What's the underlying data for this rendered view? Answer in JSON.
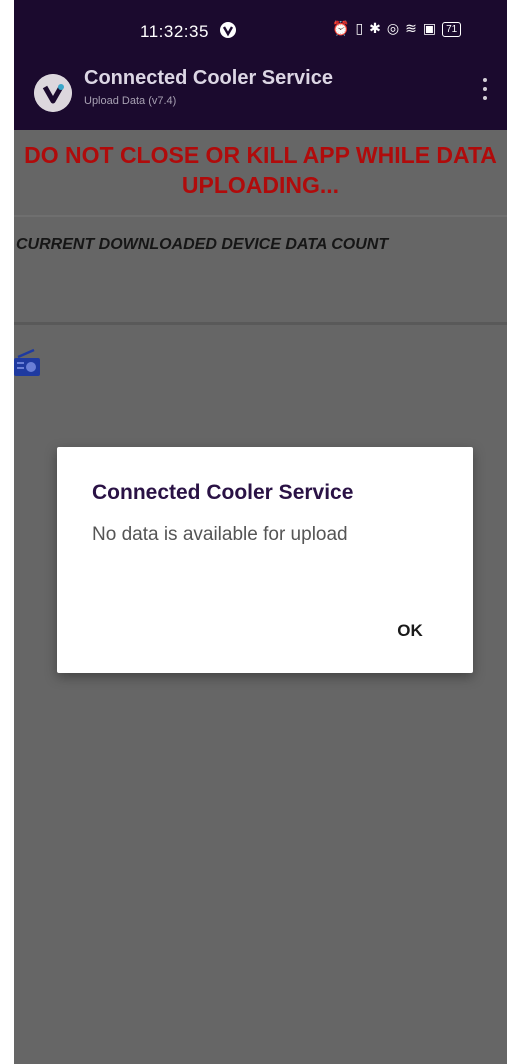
{
  "status_bar": {
    "time": "11:32:35",
    "battery": "71",
    "icons": [
      "alarm-icon",
      "vibrate-icon",
      "bluetooth-icon",
      "location-icon",
      "wifi-icon",
      "nfc-icon",
      "battery-icon"
    ]
  },
  "app_bar": {
    "title": "Connected Cooler Service",
    "subtitle": "Upload Data (v7.4)"
  },
  "content": {
    "warning": "DO NOT CLOSE OR KILL APP WHILE DATA UPLOADING...",
    "count_label": "CURRENT DOWNLOADED DEVICE DATA COUNT"
  },
  "dialog": {
    "title": "Connected Cooler Service",
    "message": "No data is available for upload",
    "ok_label": "OK"
  },
  "colors": {
    "app_bar": "#1b0a2e",
    "warning_text": "#b00b0b",
    "scrim": "#666666",
    "dialog_title": "#2a1245"
  }
}
